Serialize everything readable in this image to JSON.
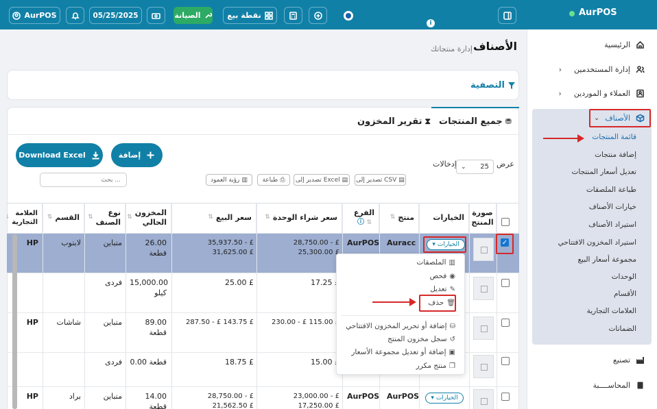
{
  "app": {
    "brand": "AurPOS",
    "account": "AurPOS"
  },
  "topbar": {
    "date": "05/25/2025",
    "pos_label": "نقطة بيع",
    "maintenance_label": "الصيانة",
    "info_mark": "i"
  },
  "sidebar": {
    "items": [
      {
        "label": "الرئيسية",
        "icon": "home-icon"
      },
      {
        "label": "إدارة المستخدمين",
        "icon": "users-icon"
      },
      {
        "label": "العملاء و الموردين",
        "icon": "contacts-icon"
      },
      {
        "label": "الأصناف",
        "icon": "box-icon"
      }
    ],
    "products_sub": [
      "قائمة المنتجات",
      "إضافة منتجات",
      "تعديل أسعار المنتجات",
      "طباعة الملصقات",
      "خيارات الأصناف",
      "استيراد الأصناف",
      "استيراد المخزون الافتتاحي",
      "مجموعة أسعار البيع",
      "الوحدات",
      "الأقسام",
      "العلامات التجارية",
      "الضمانات"
    ],
    "bottom": [
      {
        "label": "تصنيع",
        "icon": "factory-icon"
      },
      {
        "label": "المحاســــبة",
        "icon": "book-icon"
      }
    ]
  },
  "page": {
    "title": "الأصناف",
    "subtitle": "إدارة منتجاتك",
    "filter_label": "التصفية"
  },
  "tabs": [
    {
      "label": "جميع المنتجات",
      "icon": "cubes-icon",
      "active": true
    },
    {
      "label": "تقرير المخزون",
      "icon": "hourglass-icon",
      "active": false
    }
  ],
  "toolbar": {
    "add_label": "إضافة",
    "download_label": "Download Excel",
    "show_label": "عرض",
    "entries_label": "إدخالات",
    "page_length": "25",
    "search_placeholder": "بحث ...",
    "export_csv": "تصدير إلى CSV",
    "export_excel": "تصدير إلى Excel",
    "print": "طباعة",
    "column_visibility": "رؤية العمود"
  },
  "table": {
    "headers": {
      "image": "صورة المنتج",
      "actions": "الخيارات",
      "product": "منتج",
      "branch": "الفرع",
      "purchase": "سعر شراء الوحدة",
      "selling": "سعر البيع",
      "stock": "المخزون الحالي",
      "type": "نوع الصنف",
      "category": "القسم",
      "brand": "العلامة التجارية"
    },
    "actions_label": "الخيارات",
    "rows": [
      {
        "product": "Auracc",
        "branch": "AurPOS",
        "purchase": "28,750.00 - £ 25,300.00 £",
        "selling": "35,937.50 - £ 31,625.00 £",
        "stock": "26.00 قطعة",
        "type": "متباين",
        "category": "لابتوب",
        "brand": "HP",
        "checked": true
      },
      {
        "product": "",
        "branch": "",
        "purchase": "17.25 £",
        "selling": "25.00 £",
        "stock": "15,000.00 كيلو",
        "type": "فردى",
        "category": "",
        "brand": "",
        "checked": false
      },
      {
        "product": "",
        "branch": "",
        "purchase": "230.00 - £ 115.00 £",
        "selling": "287.50 - £ 143.75 £",
        "stock": "89.00 قطعة",
        "type": "متباين",
        "category": "شاشات",
        "brand": "HP",
        "checked": false
      },
      {
        "product": "",
        "branch": "",
        "purchase": "15.00 £",
        "selling": "18.75 £",
        "stock": "0.00 قطعة",
        "type": "فردى",
        "category": "",
        "brand": "",
        "checked": false
      },
      {
        "product": "AurPOS",
        "branch": "AurPOS",
        "purchase": "23,000.00 - £ 17,250.00 £",
        "selling": "28,750.00 - £ 21,562.50 £",
        "stock": "14.00 قطعة",
        "type": "متباين",
        "category": "براد",
        "brand": "HP",
        "checked": false
      }
    ]
  },
  "dropdown": {
    "items": [
      {
        "label": "الملصقات",
        "icon": "barcode-icon"
      },
      {
        "label": "فحص",
        "icon": "eye-icon"
      },
      {
        "label": "تعديل",
        "icon": "edit-icon"
      },
      {
        "label": "حذف",
        "icon": "trash-icon"
      },
      {
        "label": "إضافة أو تحرير المخزون الافتتاحي",
        "icon": "database-icon"
      },
      {
        "label": "سجل مخزون المنتج",
        "icon": "history-icon"
      },
      {
        "label": "إضافة أو تعديل مجموعة الأسعار",
        "icon": "money-icon"
      },
      {
        "label": "منتج مكرر",
        "icon": "copy-icon"
      }
    ]
  },
  "colors": {
    "primary": "#1180a7",
    "highlight": "#d62828",
    "selected_row": "#9daed0"
  }
}
